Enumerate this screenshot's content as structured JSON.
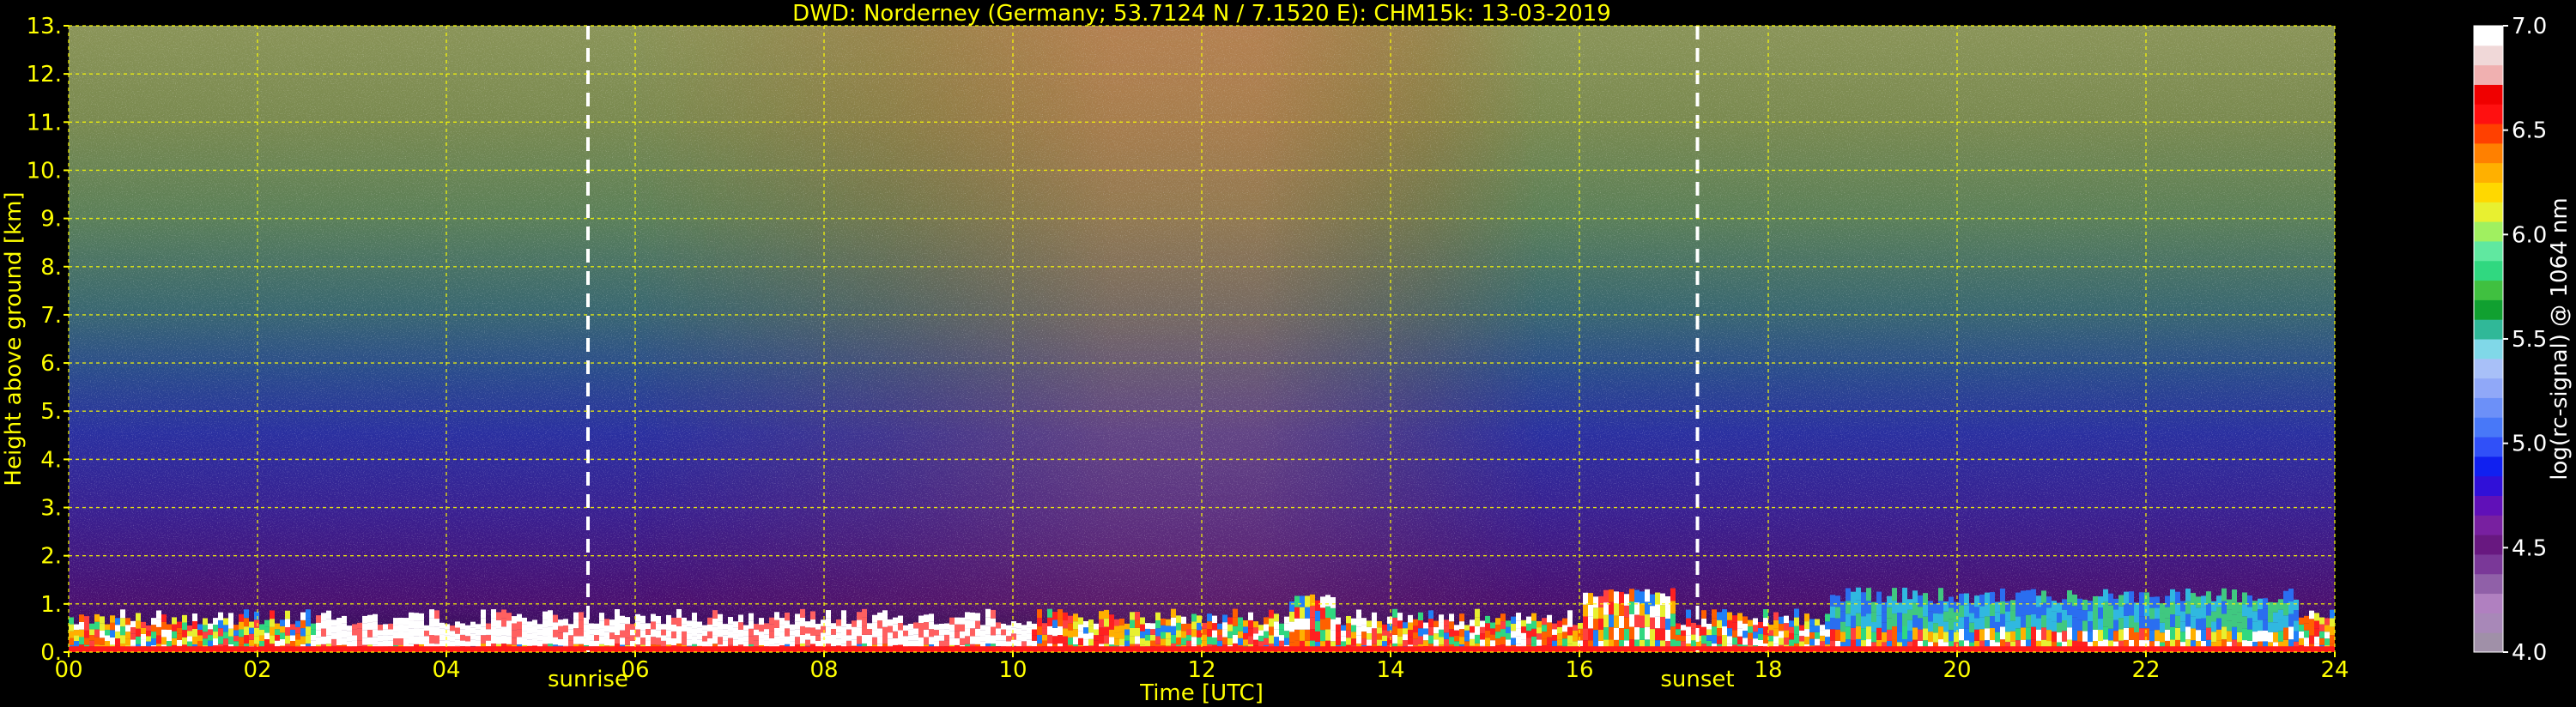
{
  "chart_data": {
    "type": "heatmap",
    "title": "DWD: Norderney (Germany; 53.7124 N / 7.1520 E):    CHM15k: 13-03-2019",
    "xlabel": "Time [UTC]",
    "ylabel": "Height above ground [km]",
    "xlim": [
      0,
      24
    ],
    "ylim": [
      0,
      13
    ],
    "x_ticks": [
      "00",
      "02",
      "04",
      "06",
      "08",
      "10",
      "12",
      "14",
      "16",
      "18",
      "20",
      "22",
      "24"
    ],
    "y_ticks": [
      "0.",
      "1.",
      "2.",
      "3.",
      "4.",
      "5.",
      "6.",
      "7.",
      "8.",
      "9.",
      "10.",
      "11.",
      "12.",
      "13."
    ],
    "grid": true,
    "grid_color": "#ffff00",
    "annotations": [
      {
        "label": "sunrise",
        "time": 5.5
      },
      {
        "label": "sunset",
        "time": 17.25
      }
    ],
    "colorbar": {
      "label": "log(rc-signal) @ 1064 nm",
      "range": [
        4.0,
        7.0
      ],
      "ticks": [
        "4.0",
        "4.5",
        "5.0",
        "5.5",
        "6.0",
        "6.5",
        "7.0"
      ],
      "colors": [
        "#a090a8",
        "#a888b8",
        "#b080c0",
        "#9060a8",
        "#7a3898",
        "#681880",
        "#7820a0",
        "#6010b8",
        "#3010d8",
        "#1020f0",
        "#3050f8",
        "#4878f8",
        "#6c90f8",
        "#90a8f8",
        "#a8c0f8",
        "#80d8e8",
        "#30b898",
        "#10a030",
        "#40c040",
        "#30d880",
        "#60e8a0",
        "#a0f060",
        "#e8f030",
        "#ffd800",
        "#ffb000",
        "#ff8000",
        "#ff4000",
        "#ff1010",
        "#f00000",
        "#f0b0b0",
        "#f0d8d8",
        "#ffffff"
      ]
    },
    "colors": {
      "background": "#000000",
      "text": "#ffff00",
      "colorbar_text": "#ffffff",
      "sun_line": "#ffffff"
    }
  }
}
